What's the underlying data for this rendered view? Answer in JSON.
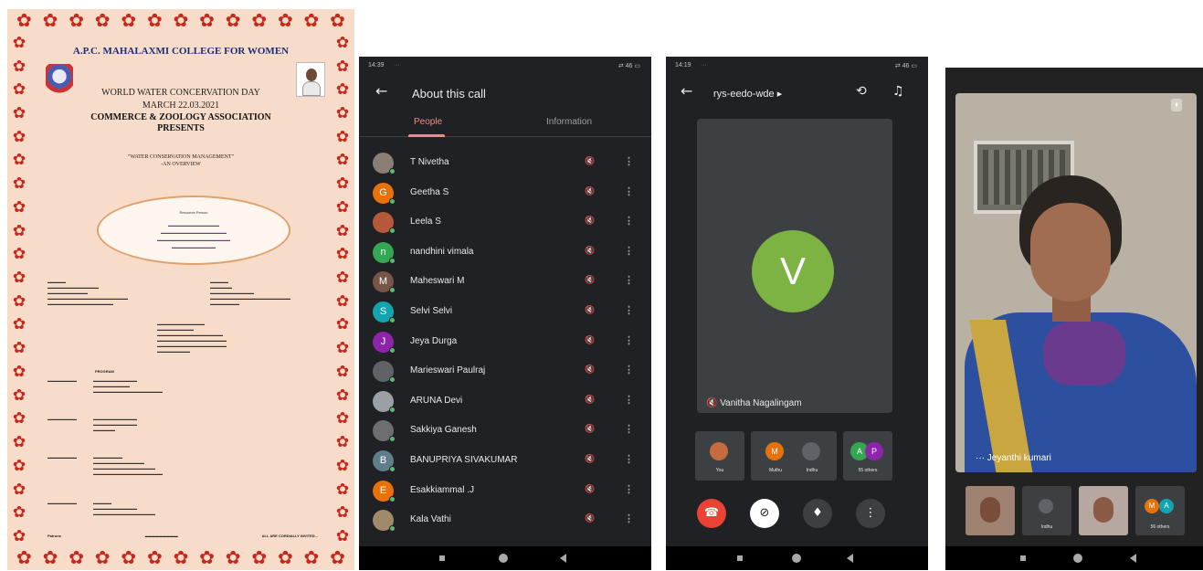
{
  "poster": {
    "college": "A.P.C. MAHALAXMI COLLEGE FOR WOMEN",
    "event_title": "WORLD WATER CONCERVATION DAY",
    "event_date": "MARCH 22.03.2021",
    "association": "COMMERCE & ZOOLOGY ASSOCIATION",
    "presents": "PRESENTS",
    "topic_line_1": "\"WATER CONSERVATION MANAGEMENT\"",
    "topic_line_2": "-AN OVERVIEW",
    "resource_title": "Resource Person",
    "programme_title": "PROGRAM",
    "patron_label": "Patrons",
    "all_invited": "ALL ARE CORDIALLY INVITED..."
  },
  "call_info": {
    "status_time": "14:39",
    "status_icons": "⇄ 46 ▭",
    "title": "About this call",
    "tab_people": "People",
    "tab_information": "Information",
    "participants": [
      {
        "name": "T Nivetha",
        "initial": "",
        "color": "#8a7f73"
      },
      {
        "name": "Geetha S",
        "initial": "G",
        "color": "#e8710a"
      },
      {
        "name": "Leela S",
        "initial": "",
        "color": "#b8583a"
      },
      {
        "name": "nandhini vimala",
        "initial": "n",
        "color": "#33a852"
      },
      {
        "name": "Maheswari M",
        "initial": "M",
        "color": "#795548"
      },
      {
        "name": "Selvi Selvi",
        "initial": "S",
        "color": "#12a4af"
      },
      {
        "name": "Jeya Durga",
        "initial": "J",
        "color": "#8e24aa"
      },
      {
        "name": "Marieswari Paulraj",
        "initial": "",
        "color": "#5f6368"
      },
      {
        "name": "ARUNA Devi",
        "initial": "",
        "color": "#9aa0a6"
      },
      {
        "name": "Sakkiya Ganesh",
        "initial": "",
        "color": "#6d6d72"
      },
      {
        "name": "BANUPRIYA SIVAKUMAR",
        "initial": "B",
        "color": "#607d8b"
      },
      {
        "name": "Esakkiammal .J",
        "initial": "E",
        "color": "#e8710a"
      },
      {
        "name": "Kala Vathi",
        "initial": "",
        "color": "#a08a6a"
      }
    ]
  },
  "meet_call": {
    "status_time": "14:19",
    "status_icons": "⇄ 46 ▭",
    "meeting_code": "rys-eedo-wde ▸",
    "speaker_initial": "V",
    "speaker_name": "Vanitha Nagalingam",
    "thumbs": [
      {
        "label": "You",
        "initial": "",
        "color": "#c66b3d"
      },
      {
        "label": "Muthu",
        "initial": "M",
        "color": "#e8710a"
      },
      {
        "label": "Indhu",
        "initial": "",
        "color": "#5f6368"
      },
      {
        "label": "55 others",
        "initial": "A",
        "color": "#33a852"
      }
    ],
    "colors": {
      "accent": "#7cb342",
      "hangup": "#ea4335"
    }
  },
  "video_call": {
    "speaker_name": "Jeyanthi kumari",
    "thumbs": [
      {
        "label": ""
      },
      {
        "label": "Indhu"
      },
      {
        "label": ""
      },
      {
        "label": "56 others"
      }
    ]
  }
}
